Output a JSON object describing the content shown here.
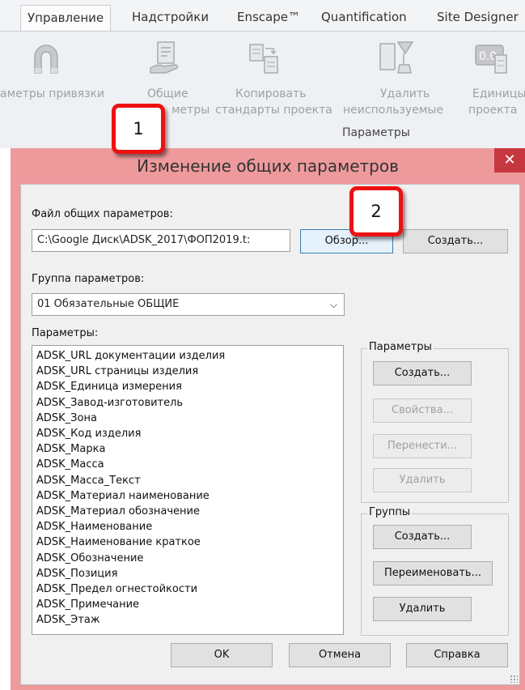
{
  "ribbon": {
    "tabs": [
      "Управление",
      "Надстройки",
      "Enscape™",
      "Quantification",
      "Site Designer"
    ],
    "active_tab": "Управление",
    "buttons": [
      {
        "label": "аметры привязки",
        "icon": "magnet-icon"
      },
      {
        "label_line1": "Общие",
        "label_line2": "метры",
        "icon": "shared-parameters-icon"
      },
      {
        "label_line1": "Копировать",
        "label_line2": "стандарты проекта",
        "icon": "transfer-standards-icon"
      },
      {
        "label_line1": "Удалить",
        "label_line2": "неиспользуемые",
        "icon": "purge-icon"
      },
      {
        "label_line1": "Единицы",
        "label_line2": "проекта",
        "icon": "project-units-icon"
      }
    ],
    "group_title": "Параметры",
    "unit_icon_text": "0.0"
  },
  "callouts": {
    "first": "1",
    "second": "2"
  },
  "dialog": {
    "title": "Изменение общих параметров",
    "close_glyph": "✕",
    "file_label": "Файл общих параметров:",
    "file_path": "C:\\Google Диск\\ADSK_2017\\ФОП2019.t:",
    "browse_label": "Обзор...",
    "create_file_label": "Создать...",
    "group_label": "Группа параметров:",
    "group_value": "01 Обязательные ОБЩИЕ",
    "params_label": "Параметры:",
    "parameters": [
      "ADSK_URL документации изделия",
      "ADSK_URL страницы изделия",
      "ADSK_Единица измерения",
      "ADSK_Завод-изготовитель",
      "ADSK_Зона",
      "ADSK_Код изделия",
      "ADSK_Марка",
      "ADSK_Масса",
      "ADSK_Масса_Текст",
      "ADSK_Материал наименование",
      "ADSK_Материал обозначение",
      "ADSK_Наименование",
      "ADSK_Наименование краткое",
      "ADSK_Обозначение",
      "ADSK_Позиция",
      "ADSK_Предел огнестойкости",
      "ADSK_Примечание",
      "ADSK_Этаж"
    ],
    "params_group": {
      "title": "Параметры",
      "create": "Создать...",
      "properties": "Свойства...",
      "move": "Перенести...",
      "delete": "Удалить"
    },
    "groups_group": {
      "title": "Группы",
      "create": "Создать...",
      "rename": "Переименовать...",
      "delete": "Удалить"
    },
    "ok": "OK",
    "cancel": "Отмена",
    "help": "Справка"
  }
}
